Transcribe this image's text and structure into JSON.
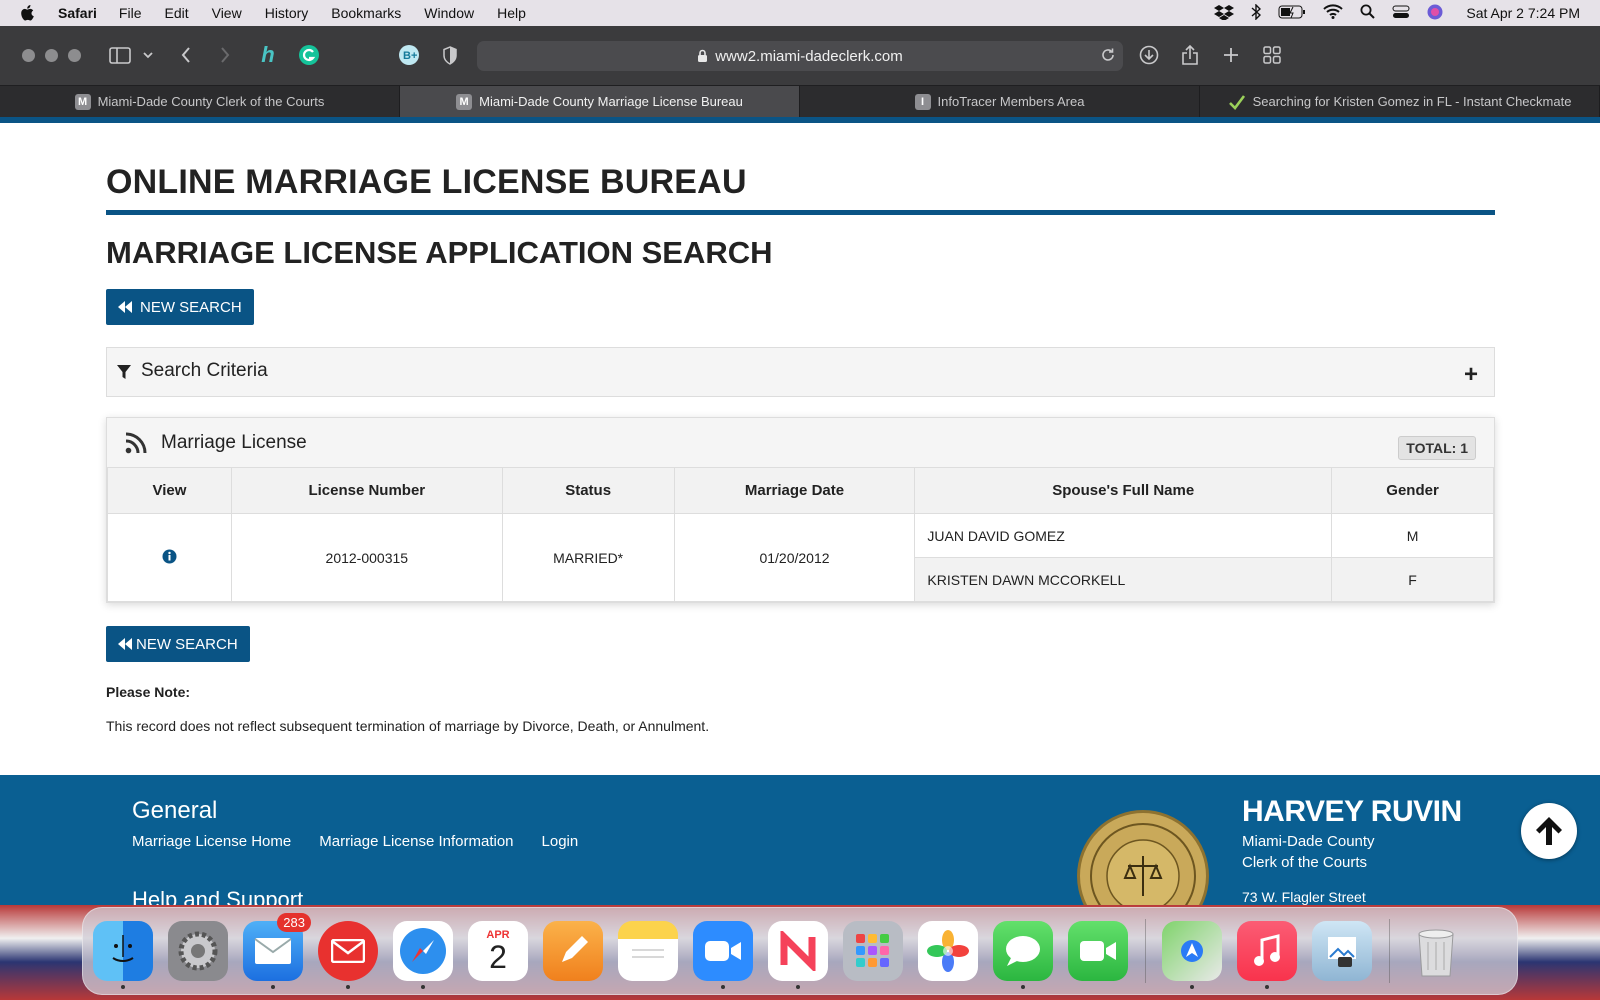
{
  "menubar": {
    "app": "Safari",
    "items": [
      "File",
      "Edit",
      "View",
      "History",
      "Bookmarks",
      "Window",
      "Help"
    ],
    "clock": "Sat Apr 2  7:24 PM"
  },
  "toolbar": {
    "url": "www2.miami-dadeclerk.com"
  },
  "tabs": [
    {
      "favicon": "M",
      "label": "Miami-Dade County Clerk of the Courts"
    },
    {
      "favicon": "M",
      "label": "Miami-Dade County Marriage License Bureau"
    },
    {
      "favicon": "I",
      "label": "InfoTracer Members Area"
    },
    {
      "favicon": "",
      "label": "Searching for Kristen Gomez in FL - Instant Checkmate"
    }
  ],
  "page": {
    "h1": "ONLINE MARRIAGE LICENSE BUREAU",
    "h2": "MARRIAGE LICENSE APPLICATION SEARCH",
    "new_search_top": "NEW SEARCH",
    "new_search_bottom": "NEW SEARCH",
    "criteria_title": "Search Criteria",
    "results_title": "Marriage License",
    "total": "TOTAL: 1",
    "columns": [
      "View",
      "License Number",
      "Status",
      "Marriage Date",
      "Spouse's Full Name",
      "Gender"
    ],
    "record": {
      "license_number": "2012-000315",
      "status": "MARRIED*",
      "marriage_date": "01/20/2012",
      "spouses": [
        {
          "name": "JUAN DAVID GOMEZ",
          "gender": "M"
        },
        {
          "name": "KRISTEN DAWN MCCORKELL",
          "gender": "F"
        }
      ]
    },
    "note_label": "Please Note:",
    "note_text": "This record does not reflect subsequent termination of marriage by Divorce, Death, or Annulment."
  },
  "footer": {
    "general": "General",
    "links": [
      "Marriage License Home",
      "Marriage License Information",
      "Login"
    ],
    "help": "Help and Support",
    "clerk_name": "HARVEY RUVIN",
    "org1": "Miami-Dade County",
    "org2": "Clerk of the Courts",
    "address": "73 W. Flagler Street"
  },
  "dock": {
    "mail_badge": "283",
    "calendar_month": "APR",
    "calendar_day": "2"
  },
  "colors": {
    "brand": "#0a5485",
    "footer": "#0a5f92"
  }
}
